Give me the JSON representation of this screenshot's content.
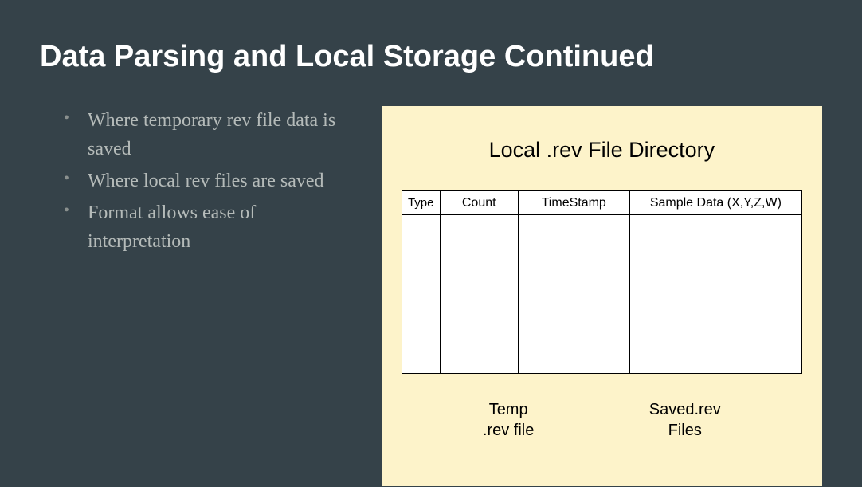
{
  "title": "Data Parsing and Local Storage Continued",
  "bullets": {
    "items": [
      "Where temporary rev file data is saved",
      "Where local rev files are saved",
      "Format allows ease of interpretation"
    ]
  },
  "diagram": {
    "title": "Local .rev File Directory",
    "columns": {
      "type": "Type",
      "count": "Count",
      "timestamp": "TimeStamp",
      "sample": "Sample Data (X,Y,Z,W)"
    },
    "labels": {
      "left": "Temp\n.rev file",
      "right": "Saved.rev\nFiles"
    }
  }
}
